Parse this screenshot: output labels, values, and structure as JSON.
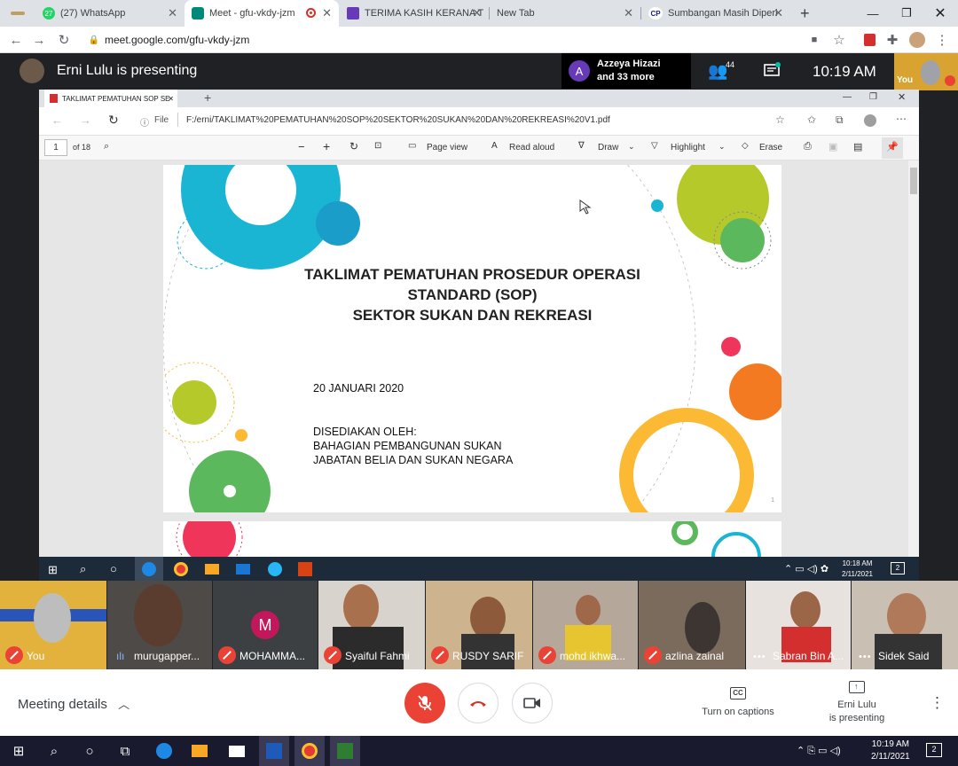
{
  "browser": {
    "tabs": [
      {
        "label": "",
        "active": false
      },
      {
        "label": "(27) WhatsApp",
        "active": false
      },
      {
        "label": "Meet - gfu-vkdy-jzm",
        "active": true
      },
      {
        "label": "TERIMA KASIH KERANA T",
        "active": false
      },
      {
        "label": "New Tab",
        "active": false
      },
      {
        "label": "Sumbangan Masih Diperl",
        "active": false
      }
    ],
    "url": "meet.google.com/gfu-vkdy-jzm",
    "whatsapp_badge": "27",
    "sumbangan_favicon": "CP"
  },
  "meet": {
    "presenter_text": "Erni Lulu is presenting",
    "speaker_initial": "A",
    "speaker_name": "Azzeya Hizazi",
    "speaker_more": "and 33 more",
    "people_count": "44",
    "time": "10:19 AM",
    "self_label": "You"
  },
  "shared_window": {
    "tab_title": "TAKLIMAT PEMATUHAN SOP SE",
    "file_label": "File",
    "file_path": "F:/erni/TAKLIMAT%20PEMATUHAN%20SOP%20SEKTOR%20SUKAN%20DAN%20REKREASI%20V1.pdf",
    "page_number": "1",
    "page_total": "of 18",
    "toolbar": {
      "page_view": "Page view",
      "read_aloud": "Read aloud",
      "draw": "Draw",
      "highlight": "Highlight",
      "erase": "Erase"
    },
    "slide": {
      "title_line1": "TAKLIMAT PEMATUHAN PROSEDUR OPERASI",
      "title_line2": "STANDARD (SOP)",
      "title_line3": "SEKTOR SUKAN DAN REKREASI",
      "date": "20 JANUARI 2020",
      "prepared_by": "DISEDIAKAN OLEH:",
      "org_line1": "BAHAGIAN PEMBANGUNAN SUKAN",
      "org_line2": "JABATAN BELIA DAN SUKAN NEGARA",
      "page_mark": "1"
    },
    "inner_clock_time": "10:18 AM",
    "inner_clock_date": "2/11/2021",
    "inner_notif": "2"
  },
  "participants": [
    {
      "name": "You",
      "avatar_letter": ""
    },
    {
      "name": "murugapper...",
      "avatar_letter": ""
    },
    {
      "name": "MOHAMMA...",
      "avatar_letter": "M"
    },
    {
      "name": "Syaiful Fahmi",
      "avatar_letter": ""
    },
    {
      "name": "RUSDY SARIF",
      "avatar_letter": ""
    },
    {
      "name": "mohd ikhwa...",
      "avatar_letter": ""
    },
    {
      "name": "azlina zainal",
      "avatar_letter": ""
    },
    {
      "name": "Sabran Bin A...",
      "avatar_letter": ""
    },
    {
      "name": "Sidek Said",
      "avatar_letter": ""
    }
  ],
  "controls": {
    "meeting_details": "Meeting details",
    "captions_label": "Turn on captions",
    "captions_icon": "CC",
    "presenting_line1": "Erni Lulu",
    "presenting_line2": "is presenting"
  },
  "taskbar": {
    "time": "10:19 AM",
    "date": "2/11/2021",
    "notifications": "2"
  },
  "colors": {
    "meet_bg": "#202124",
    "end_call_red": "#ea4335",
    "slide_cyan": "#1ab5d2",
    "slide_green": "#5cb85c",
    "slide_lime": "#b5c92a",
    "slide_orange": "#f37a21",
    "slide_yellow": "#fbb934",
    "slide_pink": "#f0355b"
  }
}
